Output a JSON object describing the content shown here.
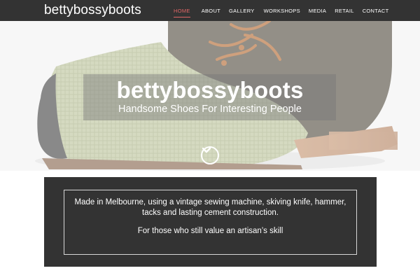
{
  "header": {
    "site_title": "bettybossyboots",
    "nav": [
      "HOME",
      "ABOUT",
      "GALLERY",
      "WORKSHOPS",
      "MEDIA",
      "RETAIL",
      "CONTACT"
    ],
    "active_nav": "HOME"
  },
  "hero": {
    "title": "bettybossyboots",
    "subtitle": "Handsome Shoes For Interesting People",
    "scroll_icon": "chevron-down-icon"
  },
  "intro": {
    "text": "Made in Melbourne, using a vintage sewing machine, skiving knife, hammer, tacks and lasting cement construction.",
    "tagline": "For those who still value an artisan’s skill"
  },
  "colors": {
    "header_bg": "#333333",
    "accent": "#e06666",
    "intro_bg": "#333333"
  }
}
